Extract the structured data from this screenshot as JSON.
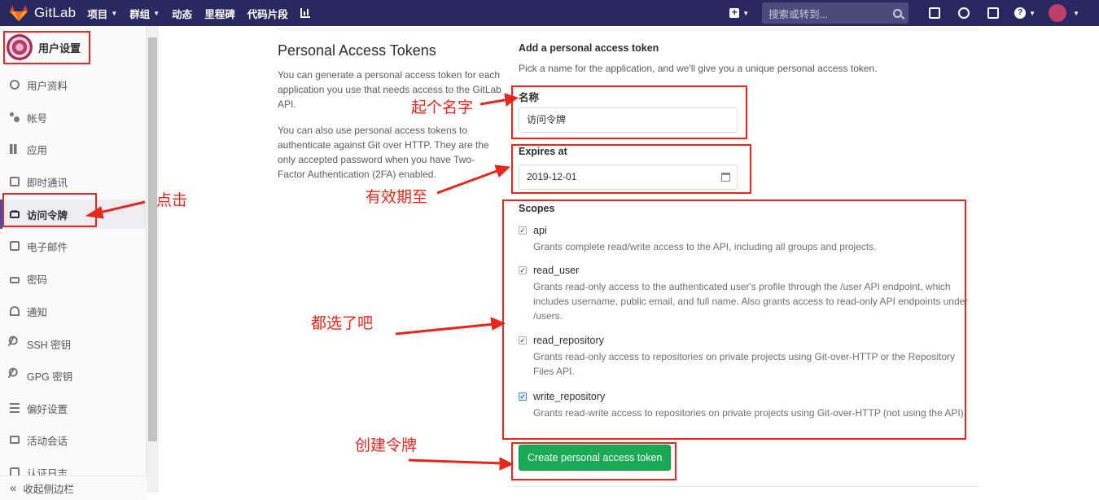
{
  "navbar": {
    "brand": "GitLab",
    "items": [
      {
        "label": "项目",
        "caret": true
      },
      {
        "label": "群组",
        "caret": true
      },
      {
        "label": "动态",
        "caret": false
      },
      {
        "label": "里程碑",
        "caret": false
      },
      {
        "label": "代码片段",
        "caret": false
      }
    ],
    "search_placeholder": "搜索或转到...",
    "icons": [
      "plus-icon",
      "sidebar-icon",
      "merge-request-icon",
      "todo-icon",
      "help-icon",
      "user-avatar"
    ]
  },
  "sidebar": {
    "title": "用户设置",
    "items": [
      {
        "label": "用户资料",
        "icon": "profile-icon",
        "active": false
      },
      {
        "label": "帐号",
        "icon": "account-icon",
        "active": false
      },
      {
        "label": "应用",
        "icon": "applications-icon",
        "active": false
      },
      {
        "label": "即时通讯",
        "icon": "chat-icon",
        "active": false
      },
      {
        "label": "访问令牌",
        "icon": "token-icon",
        "active": true
      },
      {
        "label": "电子邮件",
        "icon": "email-icon",
        "active": false
      },
      {
        "label": "密码",
        "icon": "lock-icon",
        "active": false
      },
      {
        "label": "通知",
        "icon": "bell-icon",
        "active": false
      },
      {
        "label": "SSH 密钥",
        "icon": "key-icon",
        "active": false
      },
      {
        "label": "GPG 密钥",
        "icon": "key-icon",
        "active": false
      },
      {
        "label": "偏好设置",
        "icon": "preferences-icon",
        "active": false
      },
      {
        "label": "活动会话",
        "icon": "monitor-icon",
        "active": false
      },
      {
        "label": "认证日志",
        "icon": "log-icon",
        "active": false
      }
    ],
    "collapse_label": "收起侧边栏"
  },
  "main": {
    "title": "Personal Access Tokens",
    "desc1": "You can generate a personal access token for each application you use that needs access to the GitLab API.",
    "desc2": "You can also use personal access tokens to authenticate against Git over HTTP. They are the only accepted password when you have Two-Factor Authentication (2FA) enabled.",
    "form_title": "Add a personal access token",
    "form_hint": "Pick a name for the application, and we'll give you a unique personal access token.",
    "name_label": "名称",
    "name_value": "访问令牌",
    "expires_label": "Expires at",
    "expires_value": "2019-12-01",
    "scopes_label": "Scopes",
    "scopes": [
      {
        "name": "api",
        "desc": "Grants complete read/write access to the API, including all groups and projects.",
        "checked": true
      },
      {
        "name": "read_user",
        "desc": "Grants read-only access to the authenticated user's profile through the /user API endpoint, which includes username, public email, and full name. Also grants access to read-only API endpoints under /users.",
        "checked": true
      },
      {
        "name": "read_repository",
        "desc": "Grants read-only access to repositories on private projects using Git-over-HTTP or the Repository Files API.",
        "checked": true
      },
      {
        "name": "write_repository",
        "desc": "Grants read-write access to repositories on private projects using Git-over-HTTP (not using the API).",
        "checked": true
      }
    ],
    "create_button": "Create personal access token"
  },
  "annotations": {
    "click": "点击",
    "name_it": "起个名字",
    "expiry": "有效期至",
    "select_all": "都选了吧",
    "create_token": "创建令牌",
    "color": "#e8261c"
  },
  "colors": {
    "navbar_bg": "#292961",
    "button_green": "#1aaa55",
    "annotation_red": "#e8261c"
  }
}
